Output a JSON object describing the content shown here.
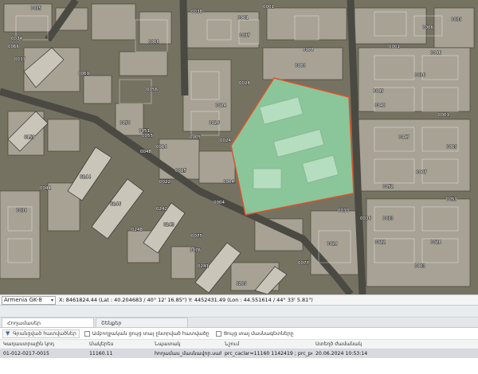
{
  "map": {
    "parcel_labels": [
      "0035",
      "0034",
      "0001",
      "0001",
      "0066",
      "0069",
      "0006",
      "0008",
      "0036",
      "0037",
      "0038",
      "0037",
      "0078",
      "0039",
      "0040",
      "0080",
      "0001",
      "0046",
      "0047",
      "0028",
      "0056",
      "0050",
      "0048",
      "0044",
      "0038",
      "0024",
      "0026",
      "0024",
      "0025",
      "0005",
      "0004",
      "0244",
      "0246",
      "0248",
      "0243",
      "0010",
      "0076",
      "0075",
      "0004",
      "0030",
      "0036",
      "0033",
      "0241",
      "0209",
      "0022",
      "0028",
      "0003",
      "0052",
      "0007",
      "0009",
      "0001",
      "0077",
      "0059",
      "0028",
      "0055",
      "0022",
      "0049",
      "0051",
      "0159",
      "0242"
    ],
    "selection_color": "#8fd3a4",
    "selection_border": "#d9532c"
  },
  "coord_bar": {
    "crs": "Armenia GK-8",
    "coords": "X: 8461824.44 (Lat : 40.204683 / 40° 12' 16.85\") Y: 4452431.49 (Lon : 44.551614 / 44° 33' 5.81\")"
  },
  "tabs": [
    {
      "label": "Հողամասեր"
    },
    {
      "label": "Շենքեր"
    }
  ],
  "toolbar": {
    "search_button": "Գրանցված հատվածներ",
    "check1": "Ամբողջական ցույց տալ ընտրված հատվածը",
    "check2": "Ցույց տալ մասնագետները"
  },
  "table": {
    "headers": [
      "Կադաստրային կոդ",
      "Մակերես",
      "Նպատակ",
      "Նշում",
      "Ստեղծ ժամանակ"
    ],
    "rows": [
      [
        "01-012-0217-0015",
        "11160.11",
        "հողամաս_մասնավոր.սահման",
        "prc_caclar=11160 1142419 ; prc_peri...",
        "20.06.2024 10:53:14"
      ]
    ]
  }
}
